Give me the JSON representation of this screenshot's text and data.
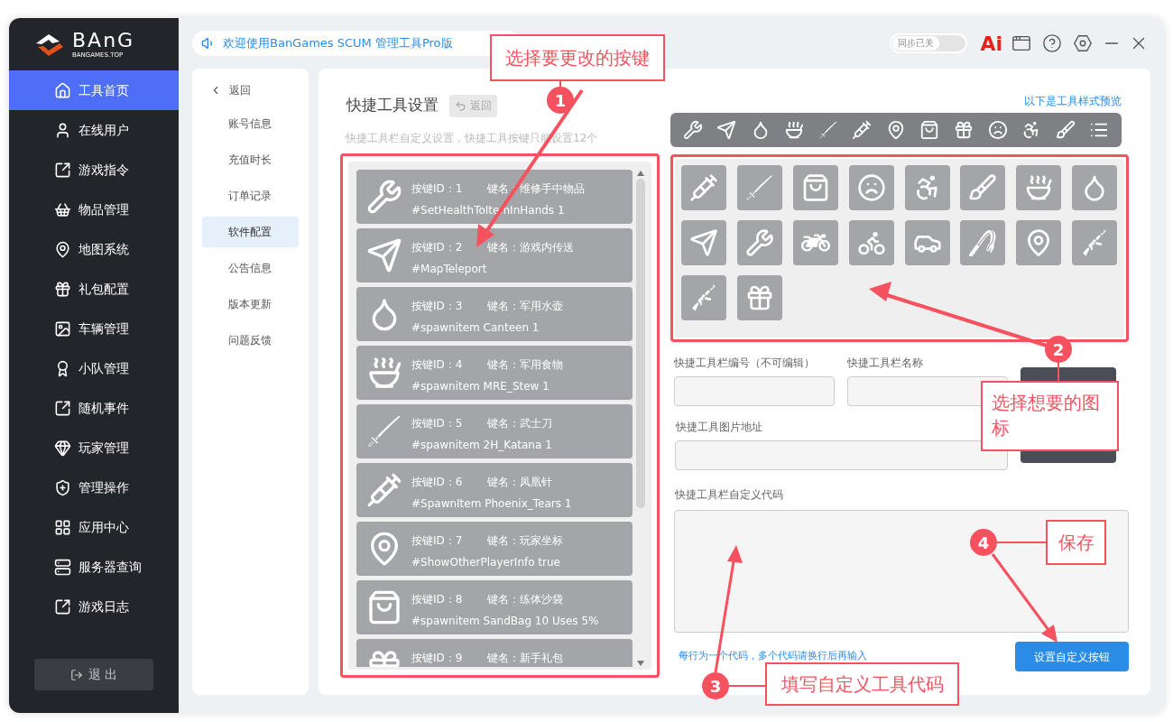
{
  "logo": {
    "brand": "BAnG",
    "site": "BANGAMES.TOP"
  },
  "sidebar": {
    "items": [
      {
        "label": "工具首页",
        "selected": true
      },
      {
        "label": "在线用户",
        "selected": false
      },
      {
        "label": "游戏指令",
        "selected": false
      },
      {
        "label": "物品管理",
        "selected": false
      },
      {
        "label": "地图系统",
        "selected": false
      },
      {
        "label": "礼包配置",
        "selected": false
      },
      {
        "label": "车辆管理",
        "selected": false
      },
      {
        "label": "小队管理",
        "selected": false
      },
      {
        "label": "随机事件",
        "selected": false
      },
      {
        "label": "玩家管理",
        "selected": false
      },
      {
        "label": "管理操作",
        "selected": false
      },
      {
        "label": "应用中心",
        "selected": false
      },
      {
        "label": "服务器查询",
        "selected": false
      },
      {
        "label": "游戏日志",
        "selected": false
      }
    ],
    "logout": "退 出"
  },
  "notice": "欢迎使用BanGames SCUM 管理工具Pro版",
  "titlebar": {
    "sync": {
      "label": "同步已关",
      "on": false
    },
    "ai": "Ai"
  },
  "submenu": {
    "back": "返回",
    "items": [
      {
        "label": "账号信息",
        "selected": false
      },
      {
        "label": "充值时长",
        "selected": false
      },
      {
        "label": "订单记录",
        "selected": false
      },
      {
        "label": "软件配置",
        "selected": true
      },
      {
        "label": "公告信息",
        "selected": false
      },
      {
        "label": "版本更新",
        "selected": false
      },
      {
        "label": "问题反馈",
        "selected": false
      }
    ]
  },
  "panel": {
    "title": "快捷工具设置",
    "back": "返回",
    "hint": "快捷工具栏自定义设置，快捷工具按键只能设置12个",
    "keys": [
      {
        "id": "按键ID：1",
        "name": "键名：维修手中物品",
        "code": "#SetHealthToItemInHands 1"
      },
      {
        "id": "按键ID：2",
        "name": "键名：游戏内传送",
        "code": "#MapTeleport"
      },
      {
        "id": "按键ID：3",
        "name": "键名：军用水壶",
        "code": "#spawnitem Canteen 1"
      },
      {
        "id": "按键ID：4",
        "name": "键名：军用食物",
        "code": "#spawnitem MRE_Stew 1"
      },
      {
        "id": "按键ID：5",
        "name": "键名：武士刀",
        "code": "#spawnitem 2H_Katana 1"
      },
      {
        "id": "按键ID：6",
        "name": "键名：凤凰针",
        "code": "#SpawnItem Phoenix_Tears 1"
      },
      {
        "id": "按键ID：7",
        "name": "键名：玩家坐标",
        "code": "#ShowOtherPlayerInfo true"
      },
      {
        "id": "按键ID：8",
        "name": "键名：练体沙袋",
        "code": "#spawnitem SandBag 10 Uses 5%"
      },
      {
        "id": "按键ID：9",
        "name": "键名：新手礼包"
      }
    ],
    "preview_link": "以下是工具样式预览",
    "form": {
      "number_label": "快捷工具栏编号（不可编辑）",
      "name_label": "快捷工具栏名称",
      "image_label": "快捷工具图片地址",
      "code_label": "快捷工具栏自定义代码",
      "code_hint": "每行为一个代码，多个代码请换行后再输入",
      "submit": "设置自定义按钮"
    }
  },
  "annotations": [
    {
      "number": "1",
      "text": "选择要更改的按键"
    },
    {
      "number": "2",
      "text": "选择想要的图标"
    },
    {
      "number": "3",
      "text": "填写自定义工具代码"
    },
    {
      "number": "4",
      "text": "保存"
    }
  ]
}
